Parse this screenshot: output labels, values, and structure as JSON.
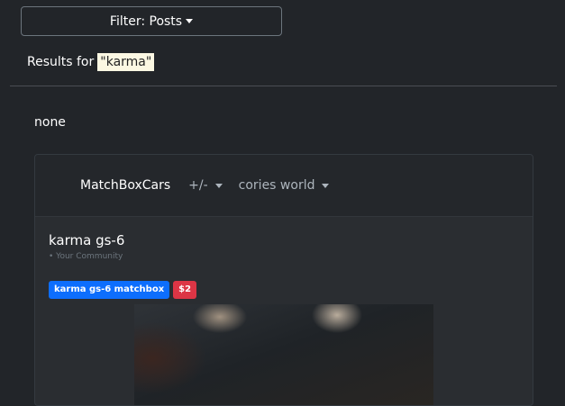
{
  "filter": {
    "label": "Filter: Posts"
  },
  "results": {
    "prefix": "Results for",
    "query": "\"karma\""
  },
  "empty_text": "none",
  "post": {
    "community": "MatchBoxCars",
    "vote_label": "+/-",
    "user": "cories world",
    "title": "karma gs-6",
    "subtitle": "• Your Community",
    "tags": [
      "karma gs-6 matchbox",
      "$2"
    ]
  },
  "colors": {
    "tag_blue": "#0d6efd",
    "tag_red": "#dc3545",
    "highlight": "#fcf8e3"
  },
  "icons": {
    "dropdown": "caret-down-icon"
  }
}
